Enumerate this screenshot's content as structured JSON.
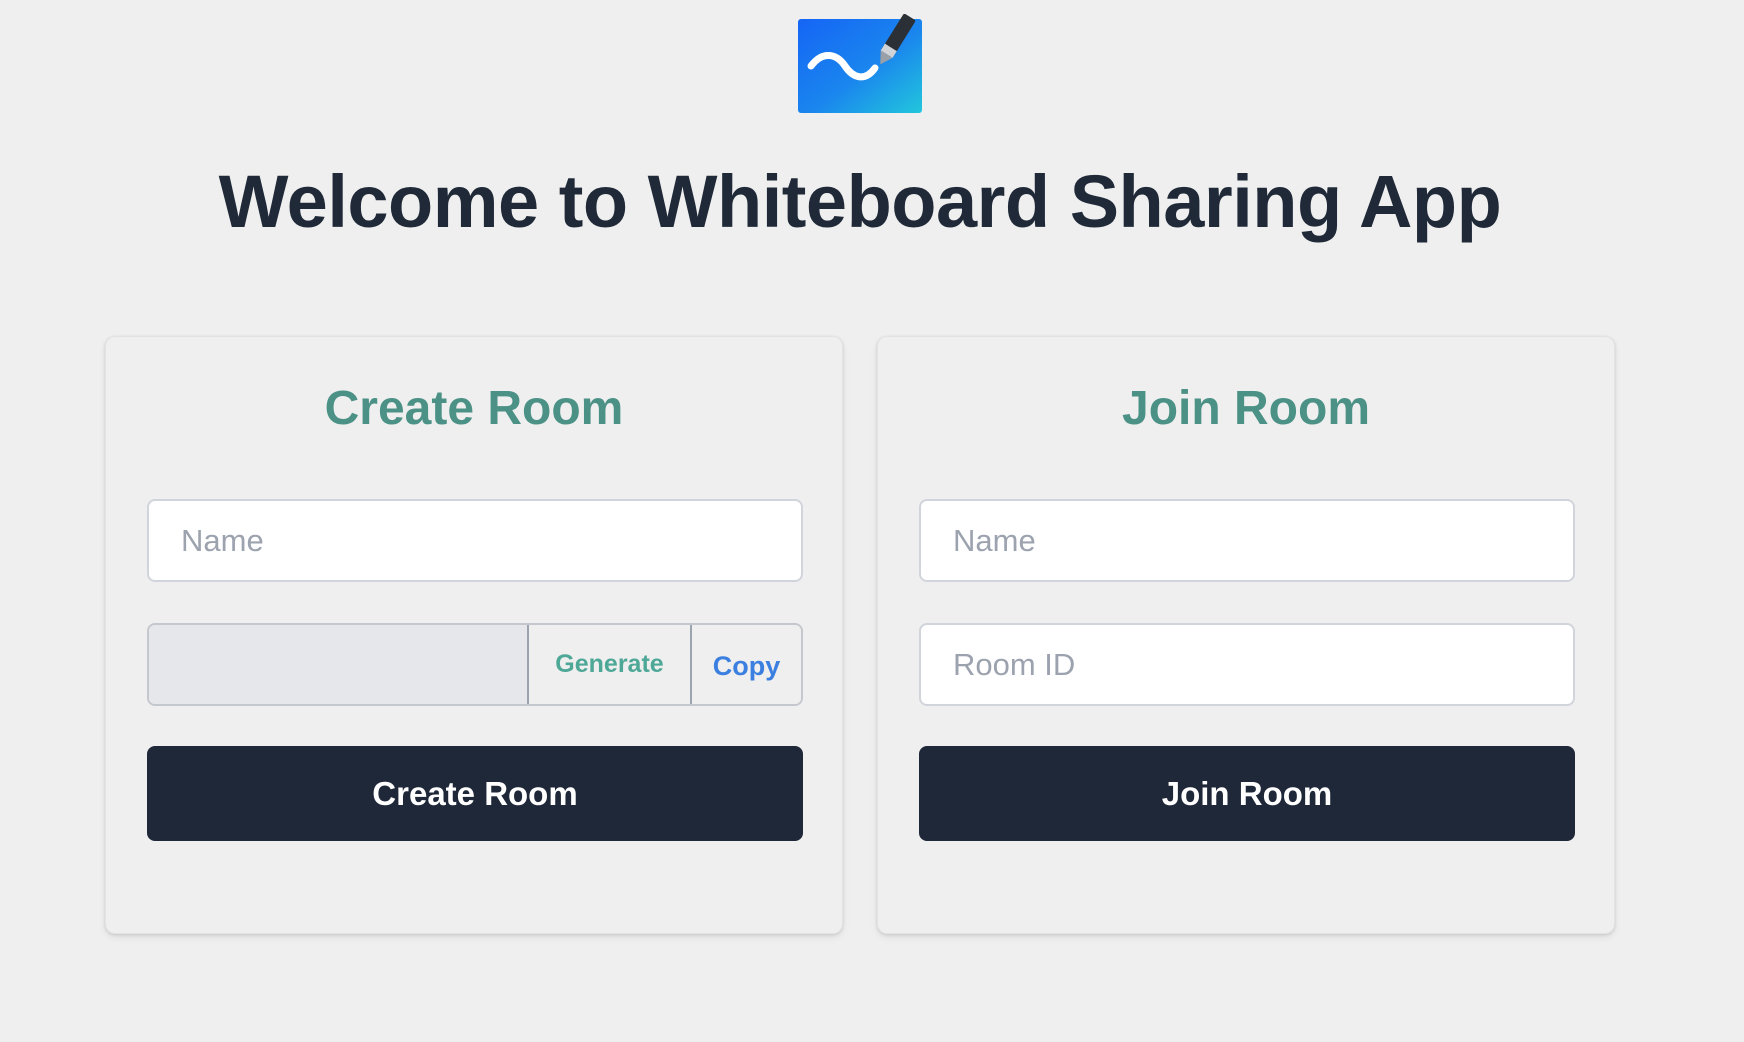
{
  "app": {
    "logo_icon": "whiteboard-pen-icon",
    "title": "Welcome to Whiteboard Sharing App"
  },
  "create_room": {
    "heading": "Create Room",
    "name_placeholder": "Name",
    "name_value": "",
    "room_code_value": "",
    "generate_label": "Generate",
    "copy_label": "Copy",
    "submit_label": "Create Room"
  },
  "join_room": {
    "heading": "Join Room",
    "name_placeholder": "Name",
    "name_value": "",
    "room_id_placeholder": "Room ID",
    "room_id_value": "",
    "submit_label": "Join Room"
  },
  "colors": {
    "background": "#efefef",
    "title_text": "#1f2937",
    "card_heading": "#4b9186",
    "generate_text": "#4ea897",
    "copy_text": "#3b7fe0",
    "primary_button": "#1f2839",
    "logo_gradient_start": "#1565f5",
    "logo_gradient_end": "#22c6dc"
  }
}
